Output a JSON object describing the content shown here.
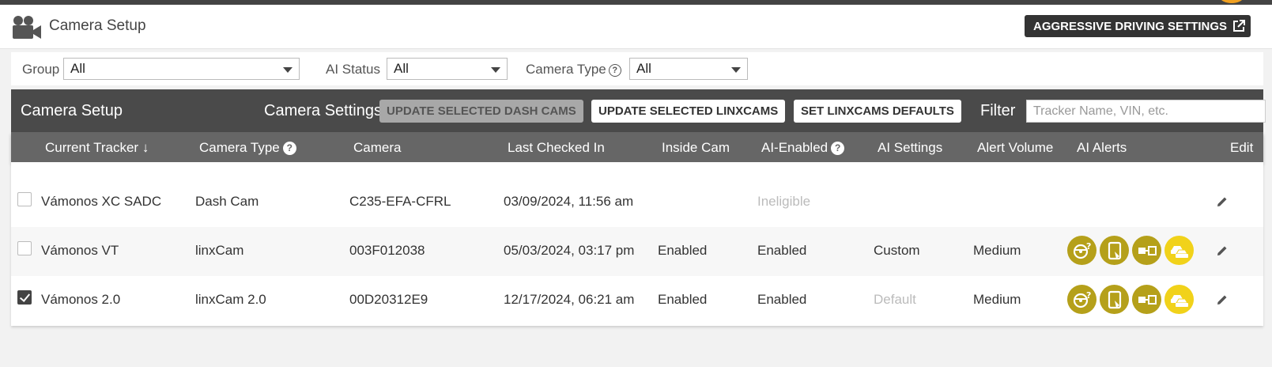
{
  "header": {
    "title": "Camera Setup",
    "aggressive_button": "AGGRESSIVE DRIVING SETTINGS"
  },
  "filters": {
    "group_label": "Group",
    "group_value": "All",
    "ai_status_label": "AI Status",
    "ai_status_value": "All",
    "camera_type_label": "Camera Type",
    "camera_type_value": "All"
  },
  "panel": {
    "title": "Camera Setup",
    "camera_settings_label": "Camera Settings",
    "update_dash_cams": "UPDATE SELECTED DASH CAMS",
    "update_linxcams": "UPDATE SELECTED LINXCAMS",
    "set_defaults": "SET LINXCAMS DEFAULTS",
    "filter_label": "Filter",
    "filter_placeholder": "Tracker Name, VIN, etc."
  },
  "columns": {
    "current_tracker": "Current Tracker",
    "camera_type": "Camera Type",
    "camera": "Camera",
    "last_checked_in": "Last Checked In",
    "inside_cam": "Inside Cam",
    "ai_enabled": "AI-Enabled",
    "ai_settings": "AI Settings",
    "alert_volume": "Alert Volume",
    "ai_alerts": "AI Alerts",
    "edit": "Edit"
  },
  "rows": [
    {
      "checked": false,
      "tracker": "Vámonos XC SADC",
      "camera_type": "Dash Cam",
      "camera": "C235-EFA-CFRL",
      "last_checked_in": "03/09/2024, 11:56 am",
      "inside_cam": "",
      "ai_enabled": "Ineligible",
      "ai_settings": "",
      "alert_volume": "",
      "has_alerts": false
    },
    {
      "checked": false,
      "tracker": "Vámonos VT",
      "camera_type": "linxCam",
      "camera": "003F012038",
      "last_checked_in": "05/03/2024, 03:17 pm",
      "inside_cam": "Enabled",
      "ai_enabled": "Enabled",
      "ai_settings": "Custom",
      "alert_volume": "Medium",
      "has_alerts": true
    },
    {
      "checked": true,
      "tracker": "Vámonos 2.0",
      "camera_type": "linxCam 2.0",
      "camera": "00D20312E9",
      "last_checked_in": "12/17/2024, 06:21 am",
      "inside_cam": "Enabled",
      "ai_enabled": "Enabled",
      "ai_settings": "Default",
      "alert_volume": "Medium",
      "has_alerts": true
    }
  ],
  "alert_icons": [
    "distracted-driver-icon",
    "phone-use-icon",
    "seatbelt-icon",
    "collision-warning-icon"
  ],
  "colors": {
    "alert_olive": "#b5a01a",
    "alert_yellow": "#f1d21a",
    "panel_dark": "#4a4a4a",
    "column_header": "#666666"
  }
}
